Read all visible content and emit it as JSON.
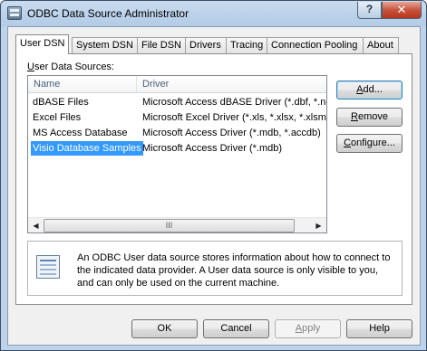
{
  "window": {
    "title": "ODBC Data Source Administrator",
    "help_glyph": "?",
    "close_glyph": "✕"
  },
  "tabs": [
    {
      "label": "User DSN",
      "active": true
    },
    {
      "label": "System DSN",
      "active": false
    },
    {
      "label": "File DSN",
      "active": false
    },
    {
      "label": "Drivers",
      "active": false
    },
    {
      "label": "Tracing",
      "active": false
    },
    {
      "label": "Connection Pooling",
      "active": false
    },
    {
      "label": "About",
      "active": false
    }
  ],
  "user_dsn": {
    "list_label_u": "U",
    "list_label_rest": "ser Data Sources:",
    "columns": {
      "name": "Name",
      "driver": "Driver"
    },
    "rows": [
      {
        "name": "dBASE Files",
        "driver": "Microsoft Access dBASE Driver (*.dbf, *.ndx"
      },
      {
        "name": "Excel Files",
        "driver": "Microsoft Excel Driver (*.xls, *.xlsx, *.xlsm,"
      },
      {
        "name": "MS Access Database",
        "driver": "Microsoft Access Driver (*.mdb, *.accdb)"
      },
      {
        "name": "Visio Database Samples",
        "driver": "Microsoft Access Driver (*.mdb)"
      }
    ],
    "selected_row": "Visio Database Samples",
    "scrollbar": {
      "left_arrow": "◀",
      "right_arrow": "▶",
      "grip": "III"
    },
    "buttons": {
      "add_u": "A",
      "add_rest": "dd...",
      "remove_u": "R",
      "remove_rest": "emove",
      "configure_u": "C",
      "configure_rest": "onfigure..."
    },
    "info_text": "An ODBC User data source stores information about how to connect to the indicated data provider.   A User data source is only visible to you, and can only be used on the current machine."
  },
  "footer": {
    "ok": "OK",
    "cancel": "Cancel",
    "apply_u": "A",
    "apply_rest": "pply",
    "help": "Help"
  },
  "colors": {
    "selection": "#3399ff",
    "close_button": "#c8553d",
    "title_bar": "#bcd3ea"
  }
}
